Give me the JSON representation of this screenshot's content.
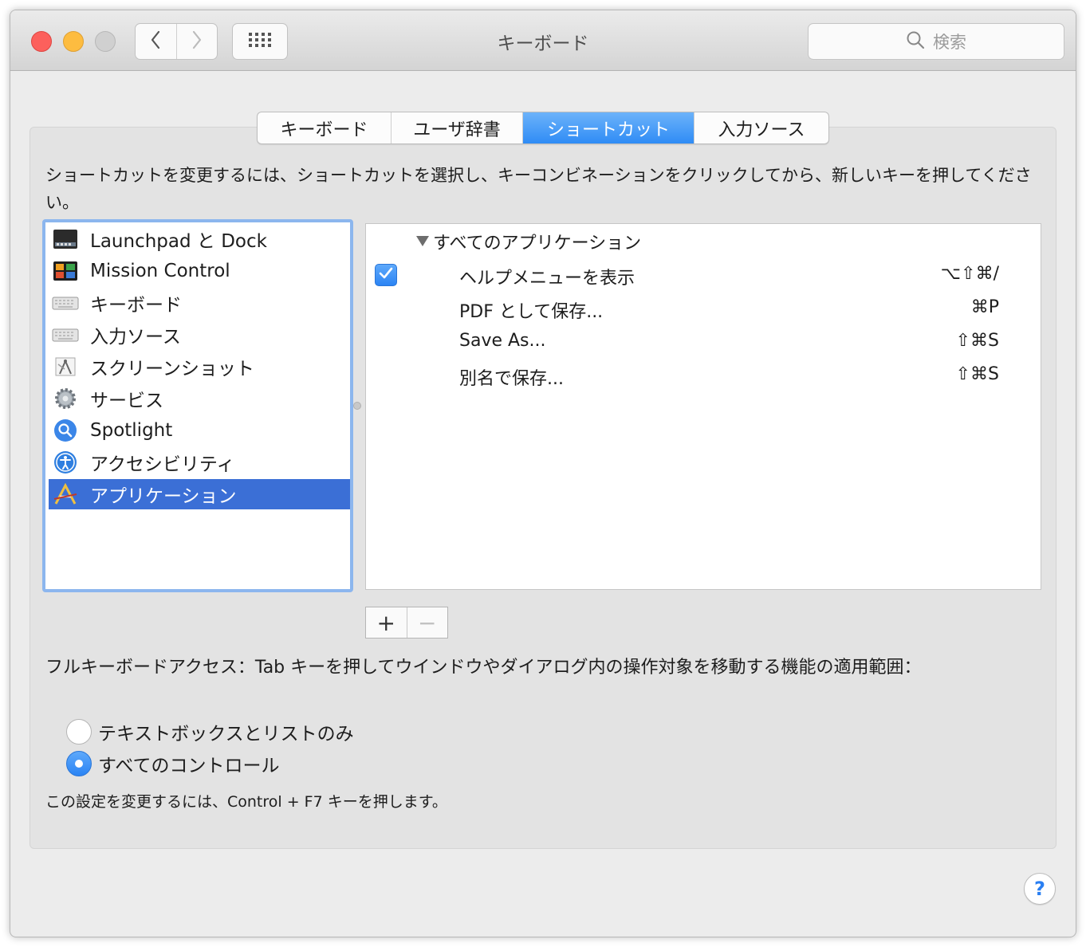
{
  "window": {
    "title": "キーボード",
    "search_placeholder": "検索"
  },
  "tabs": [
    {
      "label": "キーボード",
      "active": false
    },
    {
      "label": "ユーザ辞書",
      "active": false
    },
    {
      "label": "ショートカット",
      "active": true
    },
    {
      "label": "入力ソース",
      "active": false
    }
  ],
  "description": "ショートカットを変更するには、ショートカットを選択し、キーコンビネーションをクリックしてから、新しいキーを押してください。",
  "categories": [
    {
      "label": "Launchpad と Dock",
      "icon": "launchpad-dock-icon",
      "selected": false
    },
    {
      "label": "Mission Control",
      "icon": "mission-control-icon",
      "selected": false
    },
    {
      "label": "キーボード",
      "icon": "keyboard-icon",
      "selected": false
    },
    {
      "label": "入力ソース",
      "icon": "input-source-icon",
      "selected": false
    },
    {
      "label": "スクリーンショット",
      "icon": "screenshot-icon",
      "selected": false
    },
    {
      "label": "サービス",
      "icon": "services-gear-icon",
      "selected": false
    },
    {
      "label": "Spotlight",
      "icon": "spotlight-icon",
      "selected": false
    },
    {
      "label": "アクセシビリティ",
      "icon": "accessibility-icon",
      "selected": false
    },
    {
      "label": "アプリケーション",
      "icon": "applications-icon",
      "selected": true
    }
  ],
  "shortcuts": {
    "group_label": "すべてのアプリケーション",
    "group_expanded": true,
    "items": [
      {
        "name": "ヘルプメニューを表示",
        "keys": "⌥⇧⌘/",
        "checked": true
      },
      {
        "name": "PDF として保存...",
        "keys": "⌘P",
        "checked": null
      },
      {
        "name": "Save As...",
        "keys": "⇧⌘S",
        "checked": null
      },
      {
        "name": "別名で保存...",
        "keys": "⇧⌘S",
        "checked": null
      }
    ]
  },
  "buttons": {
    "add": "+",
    "remove": "−",
    "help": "?"
  },
  "full_keyboard_access": {
    "label": "フルキーボードアクセス：Tab キーを押してウインドウやダイアログ内の操作対象を移動する機能の適用範囲：",
    "options": [
      {
        "label": "テキストボックスとリストのみ",
        "selected": false
      },
      {
        "label": "すべてのコントロール",
        "selected": true
      }
    ],
    "note": "この設定を変更するには、Control + F7 キーを押します。"
  },
  "colors": {
    "accent": "#2f8cf5",
    "selection": "#3b6fd6",
    "close": "#fc605c",
    "minimize": "#fdbc40"
  }
}
